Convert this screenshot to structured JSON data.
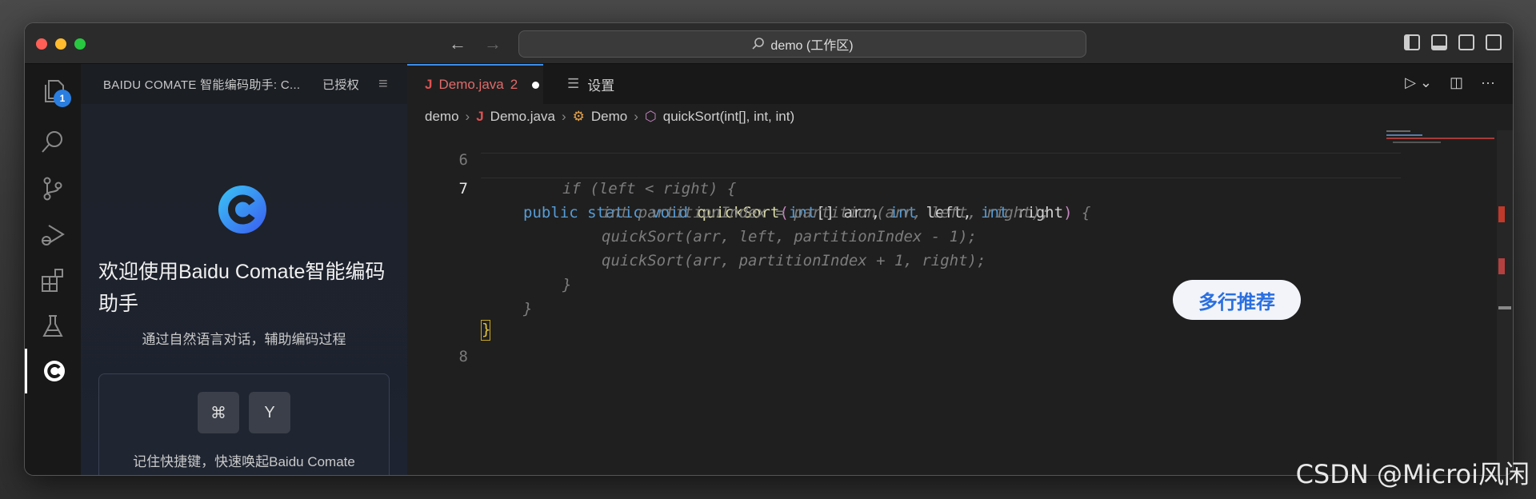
{
  "titlebar": {
    "search_text": "demo (工作区)"
  },
  "activitybar": {
    "explorer_badge": "1"
  },
  "sidebar": {
    "header_title": "BAIDU COMATE 智能编码助手: C...",
    "header_auth": "已授权",
    "welcome_title": "欢迎使用Baidu Comate智能编码助手",
    "welcome_subtitle": "通过自然语言对话，辅助编码过程",
    "shortcut_key1": "⌘",
    "shortcut_key2": "Y",
    "shortcut_hint": "记住快捷键，快速唤起Baidu Comate"
  },
  "editor": {
    "tab_file": "Demo.java",
    "tab_problems": "2",
    "tab_settings": "设置",
    "breadcrumb": {
      "folder": "demo",
      "file": "Demo.java",
      "class": "Demo",
      "method": "quickSort(int[], int, int)"
    },
    "line_numbers": {
      "l6": "6",
      "l7": "7",
      "l8": "8"
    },
    "code": {
      "public": "public",
      "static": "static",
      "void": "void",
      "fn": "quickSort",
      "paren_open": "(",
      "int1": "int",
      "arr_decl": "[] arr,",
      "int2": "int",
      "left_decl": " left,",
      "int3": "int",
      "right_decl": " right",
      "paren_close": ")",
      "brace_open": "{",
      "ghost1": "if (left < right) {",
      "ghost2": "int partitionIndex = partition(arr, left, right);",
      "ghost3": "quickSort(arr, left, partitionIndex - 1);",
      "ghost4": "quickSort(arr, partitionIndex + 1, right);",
      "ghost5": "}",
      "ghost6": "}",
      "brace_close": "}"
    },
    "recommend_label": "多行推荐"
  },
  "watermark": "CSDN @Microi风闲"
}
